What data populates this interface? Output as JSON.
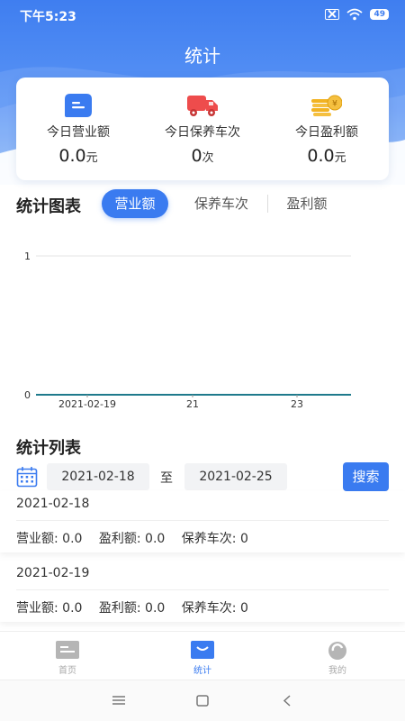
{
  "status": {
    "time": "下午5:23",
    "battery": "49"
  },
  "app": {
    "title": "统计"
  },
  "summary": [
    {
      "label": "今日营业额",
      "value": "0.0",
      "unit": "元",
      "icon": "revenue-icon",
      "color": "#3a7bf0"
    },
    {
      "label": "今日保养车次",
      "value": "0",
      "unit": "次",
      "icon": "truck-icon",
      "color": "#ee4c4c"
    },
    {
      "label": "今日盈利额",
      "value": "0.0",
      "unit": "元",
      "icon": "coins-icon",
      "color": "#f2b322"
    }
  ],
  "chart_section": {
    "title": "统计图表",
    "tabs": [
      "营业额",
      "保养车次",
      "盈利额"
    ],
    "active_tab": 0
  },
  "chart_data": {
    "type": "line",
    "x": [
      "2021-02-19",
      "21",
      "23"
    ],
    "x_tick_labels": [
      "2021-02-19",
      "21",
      "23"
    ],
    "series": [
      {
        "values": [
          0,
          0,
          0,
          0,
          0,
          0,
          0,
          0
        ],
        "color": "#1f7a8c"
      }
    ],
    "ylim": [
      0,
      1
    ],
    "y_ticks": [
      "0",
      "1"
    ],
    "grid": true
  },
  "list_section": {
    "title": "统计列表",
    "start_date": "2021-02-18",
    "to_label": "至",
    "end_date": "2021-02-25",
    "search_label": "搜索"
  },
  "records": [
    {
      "date": "2021-02-18",
      "revenue": "营业额: 0.0",
      "profit": "盈利额: 0.0",
      "services": "保养车次: 0"
    },
    {
      "date": "2021-02-19",
      "revenue": "营业额: 0.0",
      "profit": "盈利额: 0.0",
      "services": "保养车次: 0"
    }
  ],
  "tabbar": {
    "items": [
      {
        "label": "首页",
        "icon": "home-icon"
      },
      {
        "label": "统计",
        "icon": "stats-icon"
      },
      {
        "label": "我的",
        "icon": "profile-icon"
      }
    ],
    "active": 1
  },
  "colors": {
    "primary": "#3a7bf0",
    "header_top": "#3f7ef0"
  }
}
